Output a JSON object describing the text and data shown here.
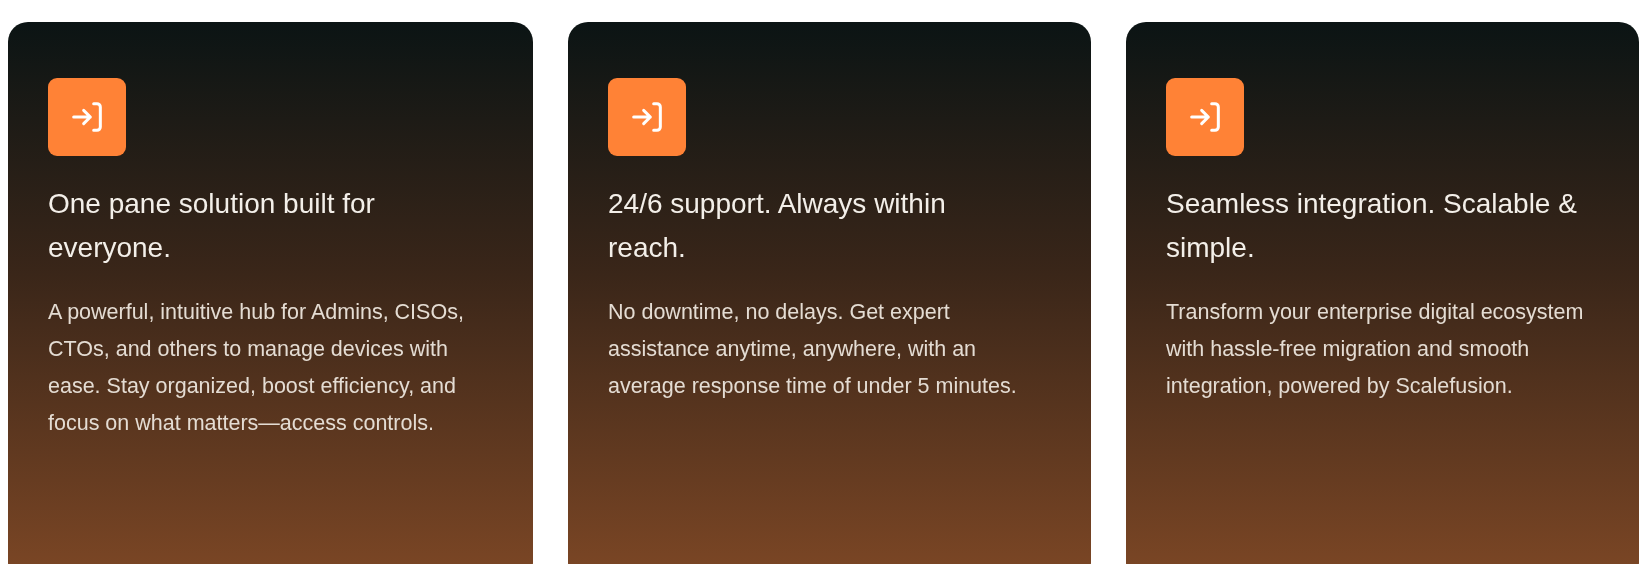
{
  "cards": [
    {
      "title": "One pane solution built for everyone.",
      "description": "A powerful, intuitive hub for Admins, CISOs, CTOs, and others to manage devices with ease. Stay organized, boost efficiency, and focus on what matters—access controls."
    },
    {
      "title": "24/6 support. Always within reach.",
      "description": "No downtime, no delays. Get expert assistance anytime, anywhere, with an average response time of under 5 minutes."
    },
    {
      "title": "Seamless integration. Scalable & simple.",
      "description": "Transform your enterprise digital ecosystem with hassle-free migration and smooth integration, powered by Scalefusion."
    }
  ]
}
